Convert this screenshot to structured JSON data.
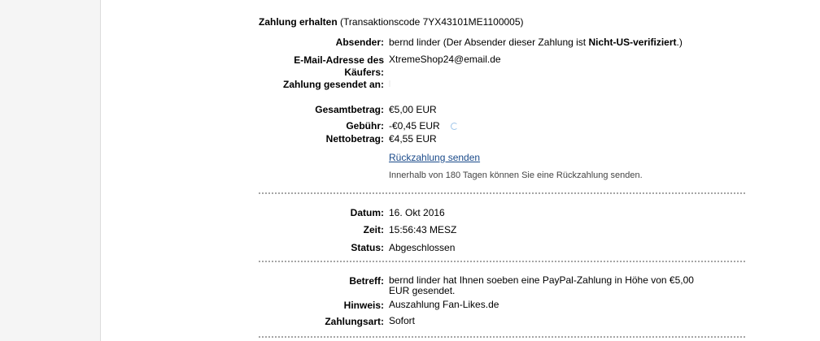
{
  "header": {
    "title": "Zahlung erhalten",
    "transaction": "(Transaktionscode 7YX43101ME1100005)"
  },
  "sender": {
    "label": "Absender:",
    "value_prefix": "bernd linder (Der Absender dieser Zahlung ist ",
    "value_bold": "Nicht-US-verifiziert",
    "value_suffix": ".)"
  },
  "email": {
    "label_line1": "E-Mail-Adresse des",
    "label_line2": "Käufers:",
    "value": "XtremeShop24@email.de"
  },
  "sent_to": {
    "label": "Zahlung gesendet an:",
    "value": ""
  },
  "totals": {
    "gross_label": "Gesamtbetrag:",
    "gross_value": "€5,00 EUR",
    "fee_label": "Gebühr:",
    "fee_value": "-€0,45 EUR",
    "net_label": "Nettobetrag:",
    "net_value": "€4,55 EUR"
  },
  "refund": {
    "link_label": "Rückzahlung senden",
    "note": "Innerhalb von 180 Tagen können Sie eine Rückzahlung senden."
  },
  "details": {
    "date_label": "Datum:",
    "date_value": "16. Okt 2016",
    "time_label": "Zeit:",
    "time_value": "15:56:43 MESZ",
    "status_label": "Status:",
    "status_value": "Abgeschlossen"
  },
  "message": {
    "subject_label": "Betreff:",
    "subject_line1": "bernd linder hat Ihnen soeben eine PayPal-Zahlung in Höhe von €5,00",
    "subject_line2": "EUR gesendet.",
    "note_label": "Hinweis:",
    "note_value": "Auszahlung Fan-Likes.de",
    "type_label": "Zahlungsart:",
    "type_value": "Sofort"
  },
  "colors": {
    "link": "#1a4a8a",
    "separator": "#a5a5a5",
    "page_background": "#f5f5f5"
  }
}
